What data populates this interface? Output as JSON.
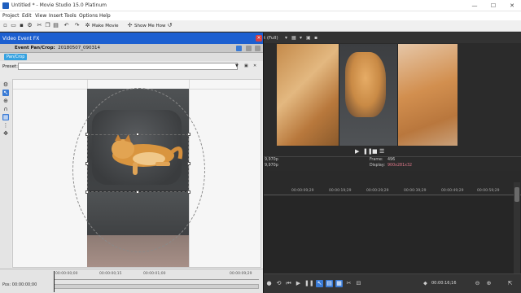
{
  "window": {
    "title": "Untitled * - Movie Studio 15.0 Platinum",
    "controls": {
      "minimize": "—",
      "maximize": "☐",
      "close": "✕"
    }
  },
  "menu": {
    "items": [
      "Project",
      "Edit",
      "View",
      "Insert",
      "Tools",
      "Options",
      "Help"
    ]
  },
  "toolbar": {
    "make_movie": "Make Movie",
    "show_me_how": "Show Me How"
  },
  "fx_panel": {
    "title": "Video Event FX",
    "event_label": "Event Pan/Crop:",
    "event_name": "20180507_090314",
    "chip": "Pan/Crop",
    "preset_label": "Preset:",
    "preset_value": "",
    "ruler_ticks": [
      "00:00:00;00",
      "00:00:00;15",
      "00:00:01;00",
      "00:00:09;29"
    ],
    "position": "Pos: 00:00:00;00"
  },
  "preview": {
    "quality": "t (Full)",
    "info": {
      "project": "9,970p",
      "preview": "9,970p",
      "frame_label": "Frame:",
      "frame_value": "496",
      "display_label": "Display:",
      "display_value": "900x281x32"
    }
  },
  "timeline": {
    "ticks": [
      "00:00:09;29",
      "00:00:19;29",
      "00:00:29;29",
      "00:00:39;29",
      "00:00:49;29",
      "00:00:59;29"
    ],
    "cursor_time": "00:00:16;16"
  },
  "colors": {
    "fx_header": "#1c5fd0",
    "selected_tool": "#3a7bd5",
    "chip": "#36a2e0",
    "display_value": "#e0788a"
  }
}
